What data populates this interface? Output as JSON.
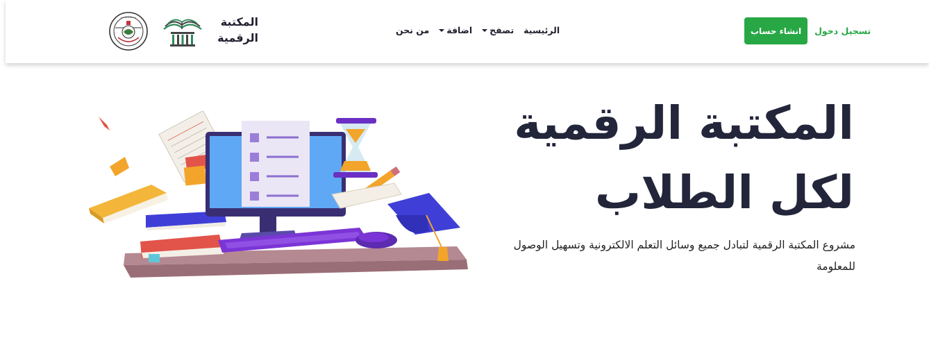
{
  "header": {
    "register_label": "انشاء حساب",
    "login_label": "تسجيل دخول",
    "nav": [
      {
        "label": "الرئيسية",
        "dropdown": false
      },
      {
        "label": "تصفح",
        "dropdown": true
      },
      {
        "label": "اضافة",
        "dropdown": true
      },
      {
        "label": "من نحن",
        "dropdown": false
      }
    ],
    "brand": {
      "line1": "المكتبة",
      "line2": "الرقمية",
      "logo_icon": "open-book-columns-logo",
      "seal_icon": "university-seal-logo"
    }
  },
  "hero": {
    "title_line1": "المكتبة الرقمية",
    "title_line2": "لكل الطلاب",
    "description": "مشروع المكتبة الرقمية لتبادل جميع وسائل التعلم الالكترونية وتسهيل الوصول للمعلومة",
    "illustration_icon": "computer-books-graduation-illustration"
  },
  "colors": {
    "accent_green": "#28a745",
    "heading_dark": "#23263a",
    "monitor_screen": "#5fa8f5",
    "keyboard_purple": "#7b35d6",
    "cap_blue": "#3f3fd8"
  }
}
